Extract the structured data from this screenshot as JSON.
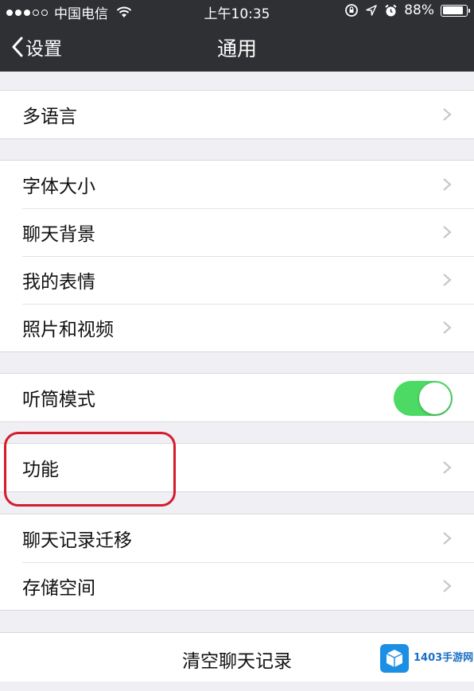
{
  "status_bar": {
    "carrier": "中国电信",
    "time": "上午10:35",
    "battery": "88%",
    "battery_level": 0.88,
    "icons": [
      "signal-dots-icon",
      "wifi-icon",
      "rotation-lock-icon",
      "location-arrow-icon",
      "alarm-icon",
      "battery-icon"
    ]
  },
  "nav": {
    "back_label": "设置",
    "title": "通用",
    "background": "#2e3033"
  },
  "groups": {
    "language": {
      "label": "多语言"
    },
    "display": {
      "items": [
        "字体大小",
        "聊天背景",
        "我的表情",
        "照片和视频"
      ]
    },
    "earpiece": {
      "label": "听筒模式",
      "toggle_on": true,
      "toggle_color": "#4cd964"
    },
    "features": {
      "label": "功能",
      "highlight_color": "#d41c2c"
    },
    "storage": {
      "items": [
        "聊天记录迁移",
        "存储空间"
      ]
    },
    "clear": {
      "label": "清空聊天记录"
    }
  },
  "watermark": {
    "text": "1403手游网"
  }
}
